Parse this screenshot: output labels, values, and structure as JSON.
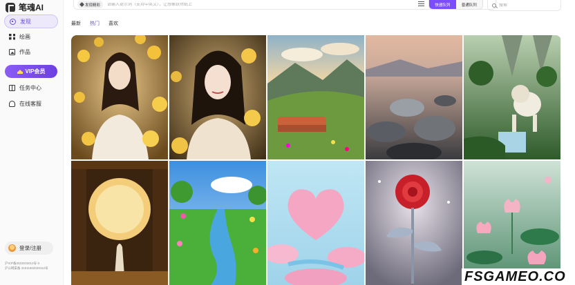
{
  "app": {
    "title": "笔魂AI"
  },
  "sidebar": {
    "items": [
      {
        "label": "发现",
        "icon": "compass-icon"
      },
      {
        "label": "绘画",
        "icon": "grid-icon"
      },
      {
        "label": "作品",
        "icon": "image-icon"
      },
      {
        "label": "任务中心",
        "icon": "gift-icon"
      },
      {
        "label": "在线客服",
        "icon": "headset-icon"
      }
    ],
    "vip_label": "VIP会员",
    "login_label": "登录/注册",
    "icp_line1": "沪ICP备2023015012号-3",
    "icp_line2": "沪公网安备 31011502020112号"
  },
  "topbar": {
    "inspire_label": "发现精彩",
    "prompt_placeholder": "请输入提示词（支持中英文），让想象跃然纸上",
    "queue_fast": "快速队列",
    "queue_normal": "普通队列",
    "search_placeholder": "搜索"
  },
  "tabs": [
    "最新",
    "热门",
    "喜欢"
  ],
  "active_tab": "热门",
  "gallery": [
    {
      "subject": "woman-with-yellow-roses"
    },
    {
      "subject": "woman-portrait-flowers"
    },
    {
      "subject": "orange-sofa-meadow-valley"
    },
    {
      "subject": "rocky-pebble-landscape"
    },
    {
      "subject": "white-lion-waterfall"
    },
    {
      "subject": "moon-gate-figure"
    },
    {
      "subject": "river-flower-meadow"
    },
    {
      "subject": "pink-heart-cloud"
    },
    {
      "subject": "crystal-red-rose"
    },
    {
      "subject": "lotus-pond"
    }
  ],
  "watermark": "FSGAMEO.CO",
  "colors": {
    "accent": "#7c4dff",
    "active_tab": "#6b4fd8"
  }
}
